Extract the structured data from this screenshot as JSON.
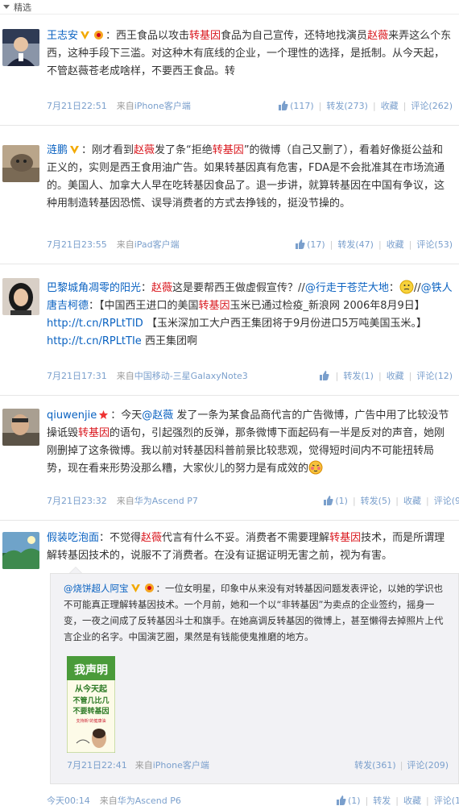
{
  "header": {
    "label": "精选"
  },
  "posts": [
    {
      "user": "王志安",
      "segments": [
        "：西王食品以攻击",
        "转基因",
        "食品为自己宣传，还特地找演员",
        "赵薇",
        "来弄这么个东西，这种手段下三滥。对这种木有底线的企业，一个理性的选择，是抵制。从今天起，不管赵薇苍老成啥样，不要西王食品。转"
      ],
      "time": "7月21日22:51",
      "source_prefix": "来自",
      "source": "iPhone客户端",
      "likes": "(117)",
      "repost": "转发(273)",
      "fav": "收藏",
      "comment": "评论(262)"
    },
    {
      "user": "涟鹏",
      "segments": [
        "：刚才看到",
        "赵薇",
        "发了条“拒绝",
        "转基因",
        "”的微博（自己又删了），看着好像挺公益和正义的，实则是西王食用油广告。如果转基因真有危害，FDA是不会批准其在市场流通的。美国人、加拿大人早在吃转基因食品了。退一步讲，就算转基因在中国有争议，这种用制造转基因恐慌、误导消费者的方式去挣钱的，挺没节操的。"
      ],
      "time": "7月21日23:55",
      "source_prefix": "来自",
      "source": "iPad客户端",
      "likes": "(17)",
      "repost": "转发(47)",
      "fav": "收藏",
      "comment": "评论(53)"
    },
    {
      "user": "巴黎城角凋零的阳光",
      "segments": [
        "：",
        "赵薇",
        "这是要帮西王做虚假宣传？//",
        "@行走于苍茫大地",
        "：",
        "//",
        "@铁人唐吉柯德",
        "：【中国西王进口的美国",
        "转基因",
        "玉米已通过检疫_新浪网 2006年8月9日】 ",
        "http://t.cn/RPLtTID",
        " 【玉米深加工大户西王集团将于9月份进口5万吨美国玉米。】 ",
        "http://t.cn/RPLtTIe",
        " 西王集团啊"
      ],
      "time": "7月21日17:31",
      "source_prefix": "来自",
      "source": "中国移动-三星GalaxyNote3",
      "likes": "",
      "repost": "转发(1)",
      "fav": "收藏",
      "comment": "评论(12)"
    },
    {
      "user": "qiuwenjie",
      "segments": [
        "：今天",
        "@赵薇",
        " 发了一条为某食品商代言的广告微博，广告中用了比较没节操诋毁",
        "转基因",
        "的语句，引起强烈的反弹，那条微博下面起码有一半是反对的声音，她刚刚删掉了这条微博。我以前对转基因科普前景比较悲观，觉得短时间内不可能扭转局势，现在看来形势没那么糟，大家伙儿的努力是有成效的"
      ],
      "time": "7月21日23:32",
      "source_prefix": "来自",
      "source": "华为Ascend P7",
      "likes": "(1)",
      "repost": "转发(5)",
      "fav": "收藏",
      "comment": "评论(9"
    },
    {
      "user": "假装吃泡面",
      "segments": [
        "：不觉得",
        "赵薇",
        "代言有什么不妥。消费者不需要理解",
        "转基因",
        "技术，而是所谓理解转基因技术的，说服不了消费者。在没有证据证明无害之前，视为有害。"
      ],
      "time": "今天00:14",
      "source_prefix": "来自",
      "source": "华为Ascend P6",
      "likes": "(1)",
      "repost": "转发",
      "fav": "收藏",
      "comment": "评论(1"
    }
  ],
  "repost": {
    "user": "@烧饼超人阿宝",
    "text": "：一位女明星，印象中从来没有对转基因问题发表评论，以她的学识也不可能真正理解转基因技术。一个月前，她和一个以“非转基因”为卖点的企业签约，摇身一变，一夜之间成了反转基因斗士和旗手。在她高调反转基因的微博上，甚至懒得去掉照片上代言企业的名字。中国演艺圈，果然是有钱能使鬼推磨的地方。",
    "image_text": [
      "我声明",
      "从今天起",
      "不管几比几",
      "不要转基因"
    ],
    "image_small": "支持新!的健康油",
    "time": "7月21日22:41",
    "source_prefix": "来自",
    "source": "iPhone客户端",
    "repost": "转发(361)",
    "comment": "评论(209)"
  },
  "colors": {
    "link": "#0a62c1",
    "keyword": "#d9141b",
    "meta": "#7a9fcc"
  }
}
